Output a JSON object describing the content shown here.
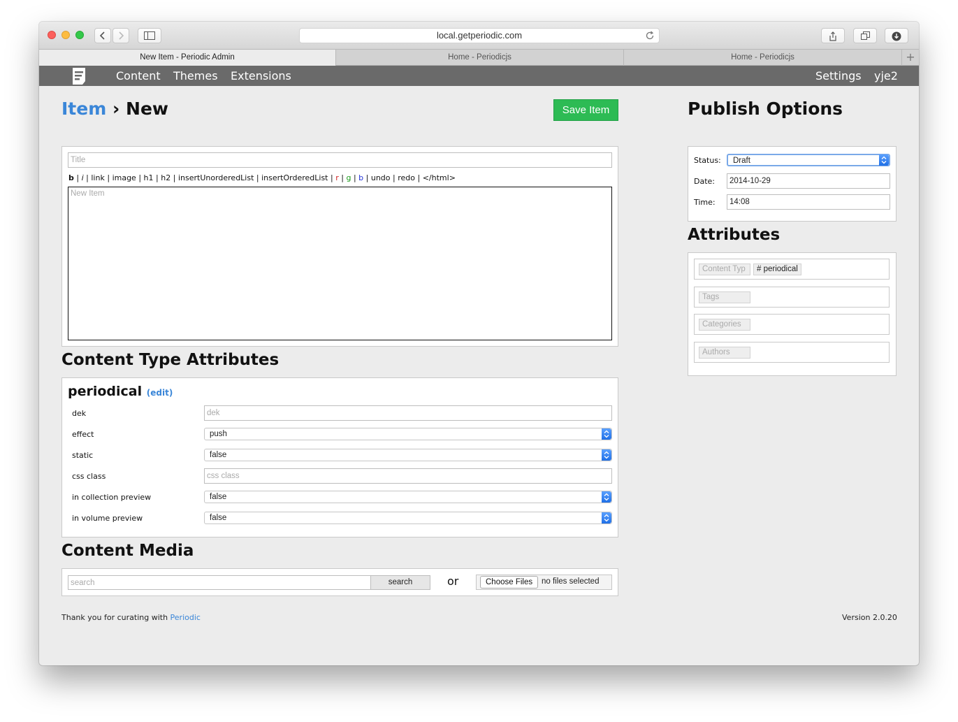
{
  "browser": {
    "url": "local.getperiodic.com",
    "tabs": [
      {
        "title": "New Item - Periodic Admin",
        "active": true
      },
      {
        "title": "Home - Periodicjs",
        "active": false
      },
      {
        "title": "Home - Periodicjs",
        "active": false
      }
    ],
    "new_tab_label": "+"
  },
  "nav": {
    "left": [
      "Content",
      "Themes",
      "Extensions"
    ],
    "right": [
      "Settings",
      "yje2"
    ]
  },
  "page": {
    "breadcrumb_link": "Item",
    "breadcrumb_sep": "›",
    "breadcrumb_current": "New",
    "save_label": "Save Item"
  },
  "editor": {
    "title_placeholder": "Title",
    "body_placeholder": "New Item",
    "toolbar": [
      {
        "label": "b",
        "style": "bold"
      },
      {
        "label": "i",
        "style": "italic"
      },
      {
        "label": "link"
      },
      {
        "label": "image"
      },
      {
        "label": "h1"
      },
      {
        "label": "h2"
      },
      {
        "label": "insertUnorderedList"
      },
      {
        "label": "insertOrderedList"
      },
      {
        "label": "r",
        "color": "#d02020"
      },
      {
        "label": "g",
        "color": "#1a9a1a"
      },
      {
        "label": "b",
        "color": "#2030d8"
      },
      {
        "label": "undo"
      },
      {
        "label": "redo"
      },
      {
        "label": "</html>"
      }
    ]
  },
  "content_type_attributes": {
    "heading": "Content Type Attributes",
    "type_name": "periodical",
    "edit_label": "(edit)",
    "fields": [
      {
        "label": "dek",
        "kind": "text",
        "placeholder": "dek",
        "value": ""
      },
      {
        "label": "effect",
        "kind": "select",
        "value": "push"
      },
      {
        "label": "static",
        "kind": "select",
        "value": "false"
      },
      {
        "label": "css class",
        "kind": "text",
        "placeholder": "css class",
        "value": ""
      },
      {
        "label": "in collection preview",
        "kind": "select",
        "value": "false"
      },
      {
        "label": "in volume preview",
        "kind": "select",
        "value": "false"
      }
    ]
  },
  "content_media": {
    "heading": "Content Media",
    "search_placeholder": "search",
    "search_button": "search",
    "or_label": "or",
    "choose_files_label": "Choose Files",
    "no_files_label": "no files selected"
  },
  "publish": {
    "heading": "Publish Options",
    "status_label": "Status:",
    "status_value": "Draft",
    "date_label": "Date:",
    "date_value": "2014-10-29",
    "time_label": "Time:",
    "time_value": "14:08"
  },
  "attributes": {
    "heading": "Attributes",
    "content_type_placeholder": "Content Typ",
    "content_type_chip": "# periodical",
    "tags_placeholder": "Tags",
    "categories_placeholder": "Categories",
    "authors_placeholder": "Authors"
  },
  "footer": {
    "thanks_text": "Thank you for curating with",
    "thanks_link": "Periodic",
    "version": "Version 2.0.20"
  },
  "colors": {
    "accent": "#3a86d8",
    "save_button": "#2dbb54",
    "navbar": "#6a6a6a"
  }
}
